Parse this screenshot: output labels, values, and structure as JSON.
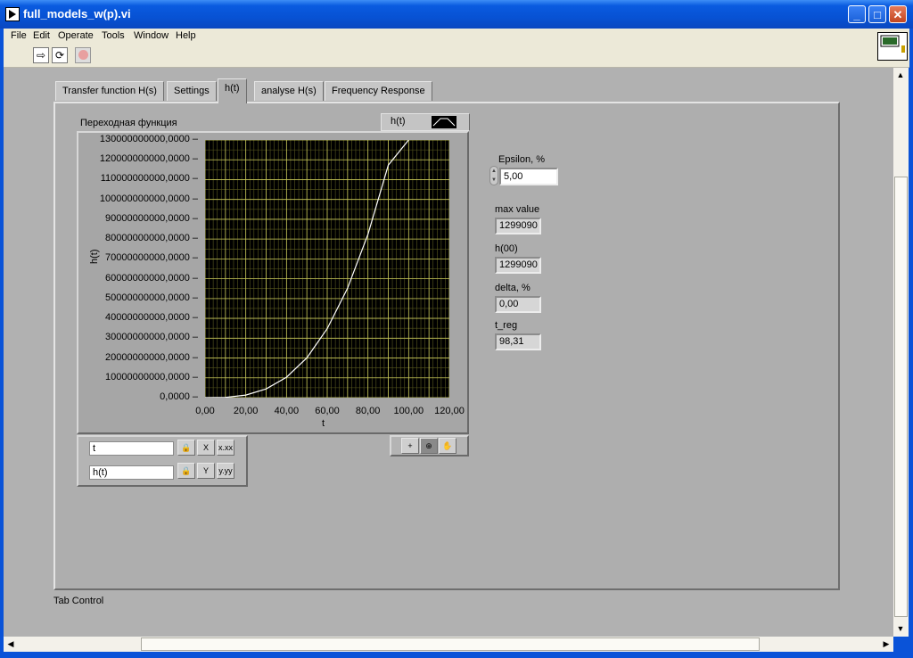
{
  "window": {
    "title": "full_models_w(p).vi"
  },
  "menu": [
    "File",
    "Edit",
    "Operate",
    "Tools",
    "Window",
    "Help"
  ],
  "tabs": [
    "Transfer function H(s)",
    "Settings",
    "h(t)",
    "analyse H(s)",
    "Frequency Response"
  ],
  "active_tab": "h(t)",
  "tab_control_label": "Tab Control",
  "graph": {
    "label": "Переходная функция",
    "legend_plot_name": "h(t)",
    "x_scale_name": "t",
    "y_scale_name": "h(t)",
    "xlabel": "t",
    "ylabel": "h(t)"
  },
  "chart_data": {
    "type": "line",
    "xlabel": "t",
    "ylabel": "h(t)",
    "xlim": [
      0,
      120
    ],
    "ylim": [
      0,
      130000000000
    ],
    "x_tick_labels": [
      "0,00",
      "20,00",
      "40,00",
      "60,00",
      "80,00",
      "100,00",
      "120,00"
    ],
    "y_tick_labels": [
      "0,0000",
      "10000000000,0000",
      "20000000000,0000",
      "30000000000,0000",
      "40000000000,0000",
      "50000000000,0000",
      "60000000000,0000",
      "70000000000,0000",
      "80000000000,0000",
      "90000000000,0000",
      "100000000000,0000",
      "110000000000,0000",
      "120000000000,0000",
      "130000000000,0000"
    ],
    "grid": true,
    "series": [
      {
        "name": "h(t)",
        "x": [
          0,
          10,
          20,
          30,
          40,
          50,
          60,
          70,
          80,
          90,
          100
        ],
        "y": [
          0,
          130000000,
          1300000000,
          4400000000,
          10300000000,
          20100000000,
          34800000000,
          55200000000,
          82400000000,
          117300000000,
          130000000000
        ]
      }
    ]
  },
  "indicators": {
    "epsilon_label": "Epsilon, %",
    "epsilon_value": "5,00",
    "max_label": "max value",
    "max_value": "1299090",
    "h00_label": "h(00)",
    "h00_value": "1299090",
    "delta_label": "delta, %",
    "delta_value": "0,00",
    "treg_label": "t_reg",
    "treg_value": "98,31"
  },
  "colors": {
    "plot_bg": "#000000",
    "grid_major": "#c8c85a",
    "grid_minor": "#5a5a20",
    "curve": "#ffffff",
    "panel": "#b1b1b1"
  }
}
